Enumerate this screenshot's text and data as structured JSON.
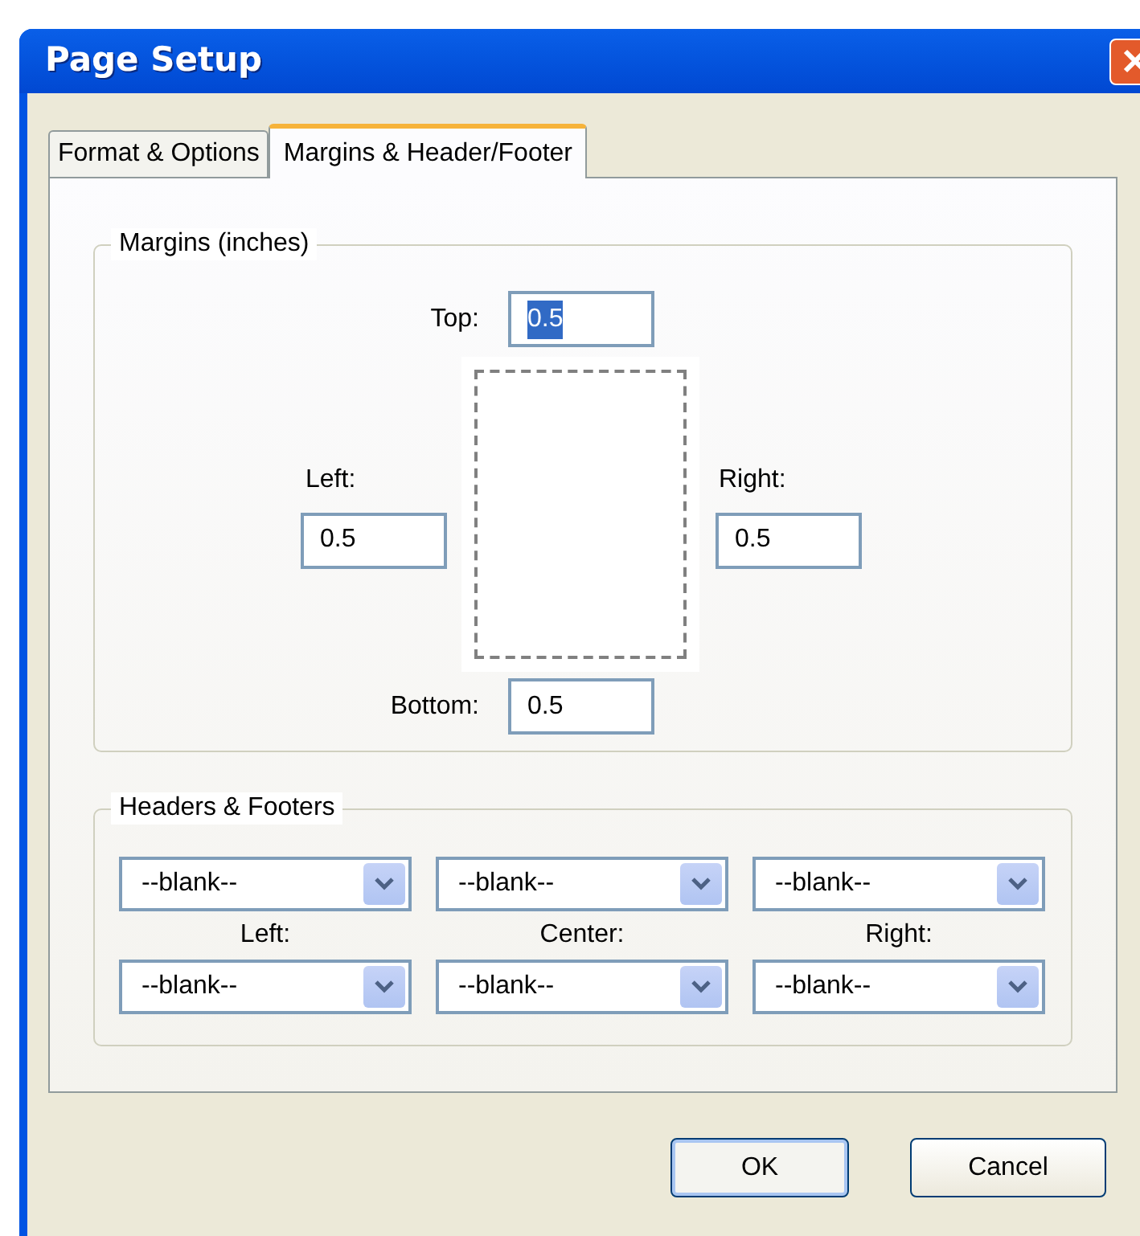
{
  "window": {
    "title": "Page Setup"
  },
  "tabs": [
    {
      "label": "Format & Options",
      "selected": false
    },
    {
      "label": "Margins & Header/Footer",
      "selected": true
    }
  ],
  "margins": {
    "title": "Margins (inches)",
    "top": {
      "label": "Top:",
      "value": "0.5",
      "highlighted": true
    },
    "left": {
      "label": "Left:",
      "value": "0.5",
      "highlighted": false
    },
    "right": {
      "label": "Right:",
      "value": "0.5",
      "highlighted": false
    },
    "bottom": {
      "label": "Bottom:",
      "value": "0.5",
      "highlighted": false
    }
  },
  "headers_footers": {
    "title": "Headers & Footers",
    "headers": [
      {
        "value": "--blank--"
      },
      {
        "value": "--blank--"
      },
      {
        "value": "--blank--"
      }
    ],
    "labels": [
      "Left:",
      "Center:",
      "Right:"
    ],
    "footers": [
      {
        "value": "--blank--"
      },
      {
        "value": "--blank--"
      },
      {
        "value": "--blank--"
      }
    ]
  },
  "buttons": [
    {
      "label": "OK",
      "default": true
    },
    {
      "label": "Cancel",
      "default": false
    }
  ]
}
